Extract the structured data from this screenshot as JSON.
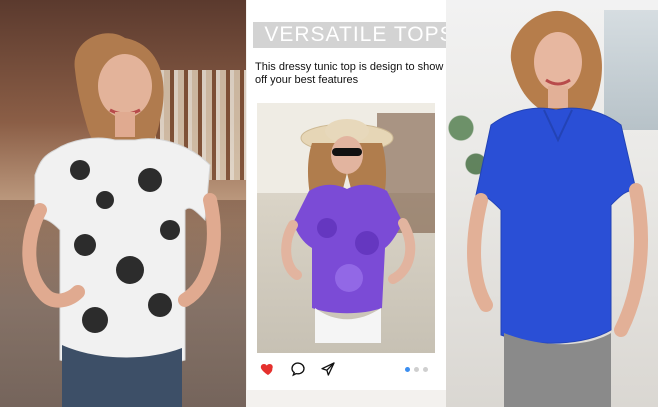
{
  "headline": "VERSATILE TOPS",
  "description": "This dressy tunic top is design to show off your best features",
  "actions": {
    "like_icon": "heart-icon",
    "comment_icon": "comment-icon",
    "share_icon": "send-icon"
  },
  "carousel": {
    "total": 3,
    "active": 1
  },
  "colors": {
    "like": "#e5302d",
    "carousel_active": "#3b8ef0",
    "headline_box": "#d3d3d3",
    "left_top": "#f1f1f1",
    "left_print": "#161616",
    "center_top": "#7b4bd6",
    "right_top": "#2a4fd6"
  }
}
